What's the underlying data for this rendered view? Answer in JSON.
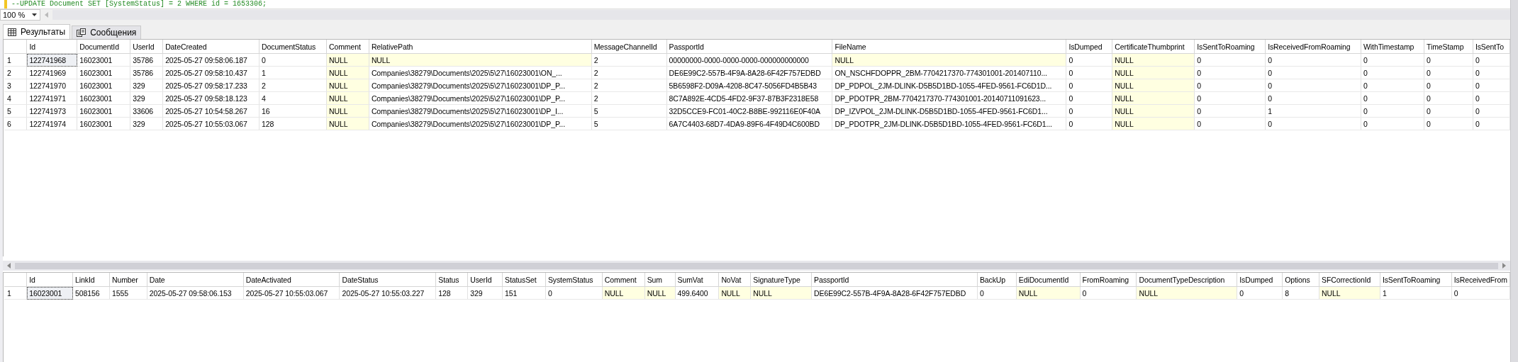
{
  "editor": {
    "code_line": "--UPDATE Document SET [SystemStatus] = 2 WHERE id = 1653306;"
  },
  "zoom": {
    "value": "100 %"
  },
  "tabs": [
    {
      "label": "Результаты",
      "selected": true,
      "kind": "grid"
    },
    {
      "label": "Сообщения",
      "selected": false,
      "kind": "messages"
    }
  ],
  "grids": [
    {
      "columns": [
        "Id",
        "DocumentId",
        "UserId",
        "DateCreated",
        "DocumentStatus",
        "Comment",
        "RelativePath",
        "MessageChannelId",
        "PassportId",
        "FileName",
        "IsDumped",
        "CertificateThumbprint",
        "IsSentToRoaming",
        "IsReceivedFromRoaming",
        "WithTimestamp",
        "TimeStamp",
        "IsSentTo"
      ],
      "rows": [
        {
          "number": "1",
          "selected": true,
          "cells": [
            "122741968",
            "16023001",
            "35786",
            "2025-05-27 09:58:06.187",
            "0",
            {
              "text": "NULL",
              "null": true
            },
            {
              "text": "NULL",
              "null": true
            },
            "2",
            "00000000-0000-0000-0000-000000000000",
            {
              "text": "NULL",
              "null": true
            },
            "0",
            {
              "text": "NULL",
              "null": true
            },
            "0",
            "0",
            "0",
            "0",
            "0"
          ]
        },
        {
          "number": "2",
          "selected": false,
          "cells": [
            "122741969",
            "16023001",
            "35786",
            "2025-05-27 09:58:10.437",
            "1",
            {
              "text": "NULL",
              "null": true
            },
            "Companies\\38279\\Documents\\2025\\5\\27\\16023001\\ON_...",
            "2",
            "DE6E99C2-557B-4F9A-8A28-6F42F757EDBD",
            "ON_NSCHFDOPPR_2BM-7704217370-774301001-201407110...",
            "0",
            {
              "text": "NULL",
              "null": true
            },
            "0",
            "0",
            "0",
            "0",
            "0"
          ]
        },
        {
          "number": "3",
          "selected": false,
          "cells": [
            "122741970",
            "16023001",
            "329",
            "2025-05-27 09:58:17.233",
            "2",
            {
              "text": "NULL",
              "null": true
            },
            "Companies\\38279\\Documents\\2025\\5\\27\\16023001\\DP_P...",
            "2",
            "5B6598F2-D09A-4208-8C47-5056FD4B5B43",
            "DP_PDPOL_2JM-DLINK-D5B5D1BD-1055-4FED-9561-FC6D1D...",
            "0",
            {
              "text": "NULL",
              "null": true
            },
            "0",
            "0",
            "0",
            "0",
            "0"
          ]
        },
        {
          "number": "4",
          "selected": false,
          "cells": [
            "122741971",
            "16023001",
            "329",
            "2025-05-27 09:58:18.123",
            "4",
            {
              "text": "NULL",
              "null": true
            },
            "Companies\\38279\\Documents\\2025\\5\\27\\16023001\\DP_P...",
            "2",
            "8C7A892E-4CD5-4FD2-9F37-87B3F2318E58",
            "DP_PDOTPR_2BM-7704217370-774301001-20140711091623...",
            "0",
            {
              "text": "NULL",
              "null": true
            },
            "0",
            "0",
            "0",
            "0",
            "0"
          ]
        },
        {
          "number": "5",
          "selected": false,
          "cells": [
            "122741973",
            "16023001",
            "33606",
            "2025-05-27 10:54:58.267",
            "16",
            {
              "text": "NULL",
              "null": true
            },
            "Companies\\38279\\Documents\\2025\\5\\27\\16023001\\DP_I...",
            "5",
            "32D5CCE9-FC01-40C2-B8BE-992116E0F40A",
            "DP_IZVPOL_2JM-DLINK-D5B5D1BD-1055-4FED-9561-FC6D1...",
            "0",
            {
              "text": "NULL",
              "null": true
            },
            "0",
            "1",
            "0",
            "0",
            "0"
          ]
        },
        {
          "number": "6",
          "selected": false,
          "cells": [
            "122741974",
            "16023001",
            "329",
            "2025-05-27 10:55:03.067",
            "128",
            {
              "text": "NULL",
              "null": true
            },
            "Companies\\38279\\Documents\\2025\\5\\27\\16023001\\DP_P...",
            "5",
            "6A7C4403-68D7-4DA9-89F6-4F49D4C600BD",
            "DP_PDOTPR_2JM-DLINK-D5B5D1BD-1055-4FED-9561-FC6D1...",
            "0",
            {
              "text": "NULL",
              "null": true
            },
            "0",
            "0",
            "0",
            "0",
            "0"
          ]
        }
      ]
    },
    {
      "columns": [
        "Id",
        "LinkId",
        "Number",
        "Date",
        "DateActivated",
        "DateStatus",
        "Status",
        "UserId",
        "StatusSet",
        "SystemStatus",
        "Comment",
        "Sum",
        "SumVat",
        "NoVat",
        "SignatureType",
        "PassportId",
        "BackUp",
        "EdiDocumentId",
        "FromRoaming",
        "DocumentTypeDescription",
        "IsDumped",
        "Options",
        "SFCorrectionId",
        "IsSentToRoaming",
        "IsReceivedFrom"
      ],
      "rows": [
        {
          "number": "1",
          "selected": true,
          "cells": [
            "16023001",
            "508156",
            "1555",
            "2025-05-27 09:58:06.153",
            "2025-05-27 10:55:03.067",
            "2025-05-27 10:55:03.227",
            "128",
            "329",
            "151",
            "0",
            {
              "text": "NULL",
              "null": true
            },
            {
              "text": "NULL",
              "null": true
            },
            "499.6400",
            {
              "text": "NULL",
              "null": true
            },
            {
              "text": "NULL",
              "null": true
            },
            "DE6E99C2-557B-4F9A-8A28-6F42F757EDBD",
            "0",
            {
              "text": "NULL",
              "null": true
            },
            "0",
            {
              "text": "NULL",
              "null": true
            },
            "0",
            "8",
            {
              "text": "NULL",
              "null": true
            },
            "1",
            "0"
          ]
        }
      ]
    }
  ]
}
